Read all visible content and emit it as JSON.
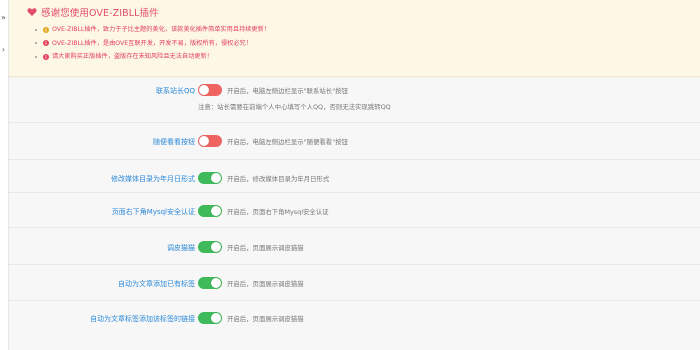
{
  "notice": {
    "title": "感谢您使用OVE-ZIBLL插件",
    "items": [
      "OVE-ZIBLL插件，致力于子比主题的美化，该款美化插件简单实用且持续更新！",
      "OVE-ZIBLL插件，是由OVE互联开发，开发不易，版权所有，侵权必究！",
      "请大家购买正版插件，盗版存在未知风险且无法自动更新！"
    ],
    "colors": {
      "background": "#fdf7e6",
      "text": "#e2415a"
    },
    "icons": [
      "heart-icon",
      "info-icon"
    ]
  },
  "settings": [
    {
      "label": "联系站长QQ",
      "enabled": false,
      "description": "开启后，电脑左侧边栏显示\"联系站长\"按钮",
      "note": "注意：站长需要在前端个人中心填写个人QQ，否则无法实现跳转QQ"
    },
    {
      "label": "随便看看按钮",
      "enabled": false,
      "description": "开启后，电脑左侧边栏显示\"随便看看\"按钮",
      "note": ""
    },
    {
      "label": "修改媒体目录为年月日形式",
      "enabled": true,
      "description": "开启后，修改媒体目录为年月日形式",
      "note": ""
    },
    {
      "label": "页面右下角Mysql安全认证",
      "enabled": true,
      "description": "开启后，页面右下角Mysql安全认证",
      "note": ""
    },
    {
      "label": "调皮猫猫",
      "enabled": true,
      "description": "开启后，页面展示调皮猫猫",
      "note": ""
    },
    {
      "label": "自动为文章添加已有标签",
      "enabled": true,
      "description": "开启后，页面展示调皮猫猫",
      "note": ""
    },
    {
      "label": "自动为文章标签添加该标签的链接",
      "enabled": true,
      "description": "开启后，页面展示调皮猫猫",
      "note": ""
    }
  ],
  "toggle_colors": {
    "on": "#3fba5a",
    "off": "#ef6461"
  }
}
